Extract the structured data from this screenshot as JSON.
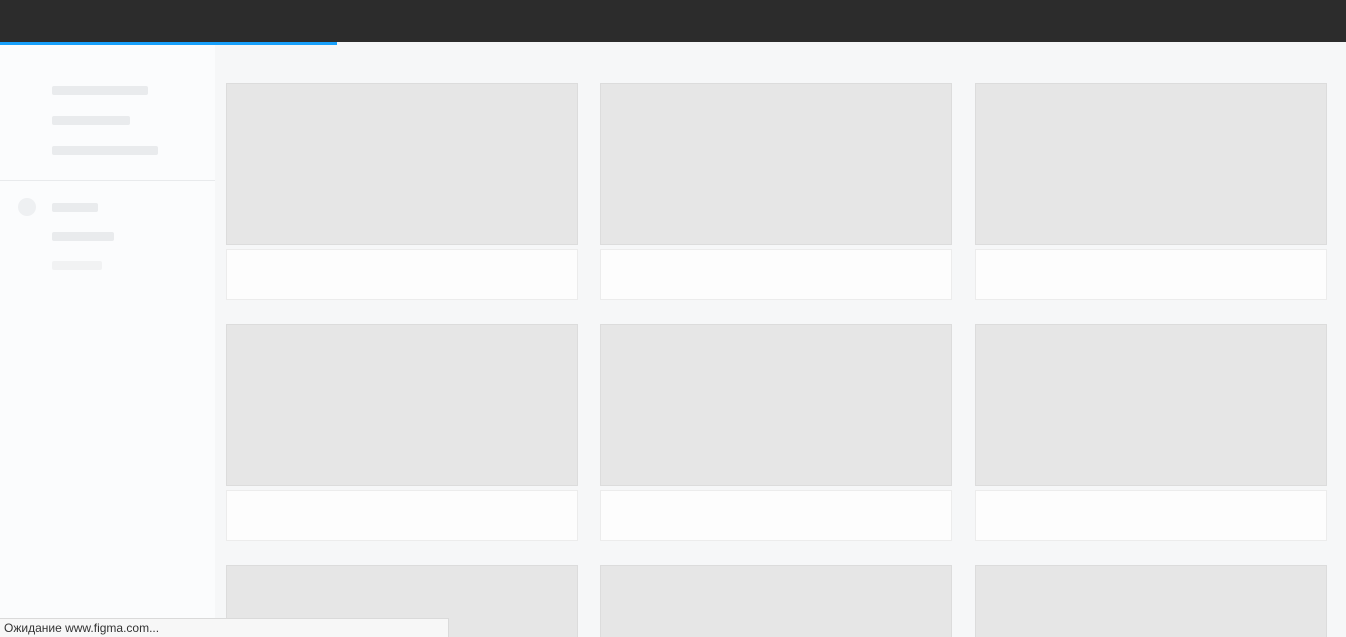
{
  "colors": {
    "topbar": "#2c2c2c",
    "progress": "#18a0fb",
    "placeholder": "#e6e6e6",
    "background": "#f6f7f8"
  },
  "loading": {
    "progress_fraction": 0.25
  },
  "statusbar": {
    "text": "Ожидание www.figma.com..."
  }
}
